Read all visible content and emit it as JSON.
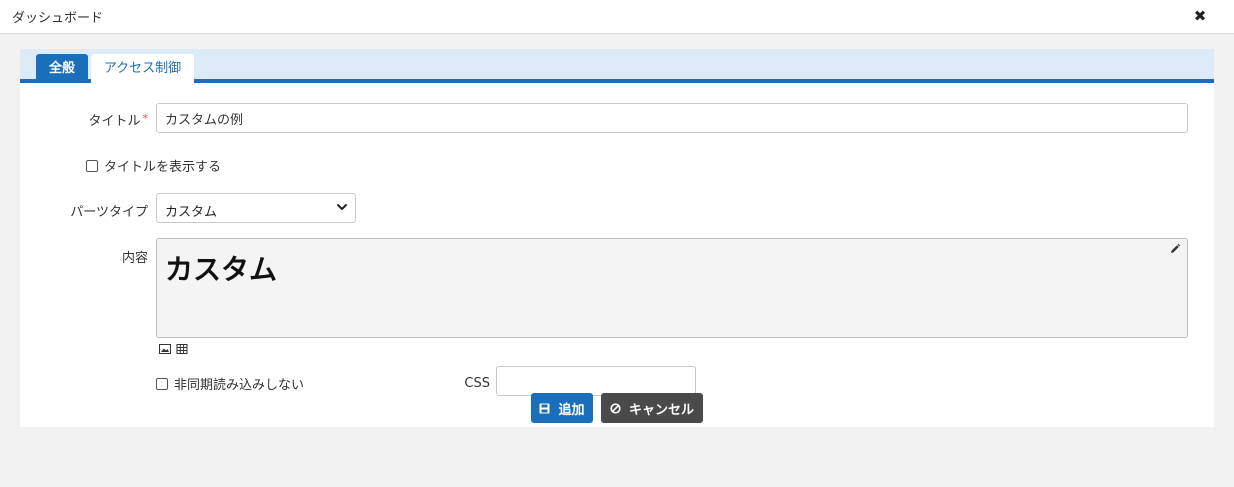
{
  "window": {
    "title": "ダッシュボード",
    "close_icon": "close-icon"
  },
  "tabs": [
    {
      "label": "全般",
      "active": true
    },
    {
      "label": "アクセス制御",
      "active": false
    }
  ],
  "form": {
    "title_label": "タイトル",
    "required_mark": "*",
    "title_value": "カスタムの例",
    "show_title_label": "タイトルを表示する",
    "show_title_checked": false,
    "part_type_label": "パーツタイプ",
    "part_type_value": "カスタム",
    "content_label": "内容",
    "content_heading": "カスタム",
    "content_icons": [
      "image-icon",
      "table-icon"
    ],
    "edit_icon": "pencil-icon",
    "async_label": "非同期読み込みしない",
    "async_checked": false,
    "css_label": "CSS",
    "css_value": ""
  },
  "buttons": {
    "add_label": "追加",
    "add_icon": "save-icon",
    "cancel_label": "キャンセル",
    "cancel_icon": "cancel-icon"
  },
  "colors": {
    "accent": "#1a6fbb",
    "tab_bar": "#ddebf8",
    "cancel_button": "#4a4a4a",
    "required": "#d9534f"
  }
}
